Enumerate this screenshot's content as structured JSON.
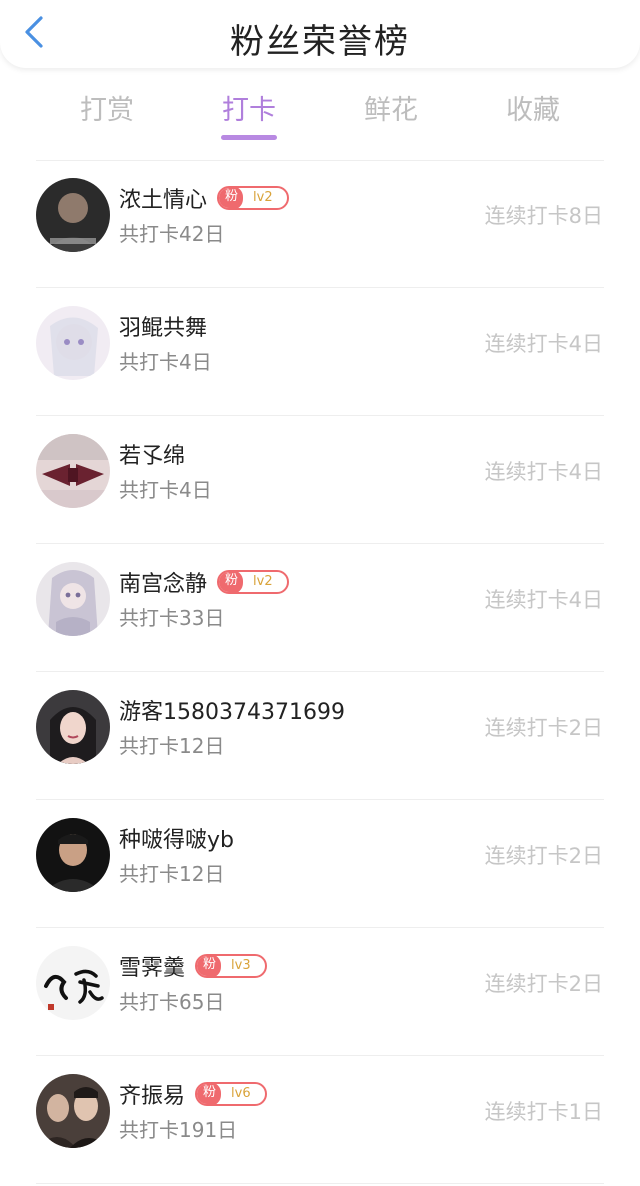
{
  "header": {
    "title": "粉丝荣誉榜",
    "back_icon": "chevron-left-icon",
    "accent_color": "#4a90e2"
  },
  "tabs": [
    {
      "label": "打赏",
      "active": false
    },
    {
      "label": "打卡",
      "active": true
    },
    {
      "label": "鲜花",
      "active": false
    },
    {
      "label": "收藏",
      "active": false
    }
  ],
  "colors": {
    "active_tab": "#b07fdc",
    "badge": "#ef6a6e",
    "badge_level_text": "#d9a33a"
  },
  "fans": [
    {
      "name": "浓土情心",
      "badge": {
        "label": "粉",
        "level": "lv2"
      },
      "total": "共打卡42日",
      "streak": "连续打卡8日"
    },
    {
      "name": "羽鲲共舞",
      "badge": null,
      "total": "共打卡4日",
      "streak": "连续打卡4日"
    },
    {
      "name": "若孓绵",
      "badge": null,
      "total": "共打卡4日",
      "streak": "连续打卡4日"
    },
    {
      "name": "南宫念静",
      "badge": {
        "label": "粉",
        "level": "lv2"
      },
      "total": "共打卡33日",
      "streak": "连续打卡4日"
    },
    {
      "name": "游客1580374371699",
      "badge": null,
      "total": "共打卡12日",
      "streak": "连续打卡2日"
    },
    {
      "name": "种啵得啵yb",
      "badge": null,
      "total": "共打卡12日",
      "streak": "连续打卡2日"
    },
    {
      "name": "雪霁羹",
      "badge": {
        "label": "粉",
        "level": "lv3"
      },
      "total": "共打卡65日",
      "streak": "连续打卡2日"
    },
    {
      "name": "齐振易",
      "badge": {
        "label": "粉",
        "level": "lv6"
      },
      "total": "共打卡191日",
      "streak": "连续打卡1日"
    }
  ]
}
